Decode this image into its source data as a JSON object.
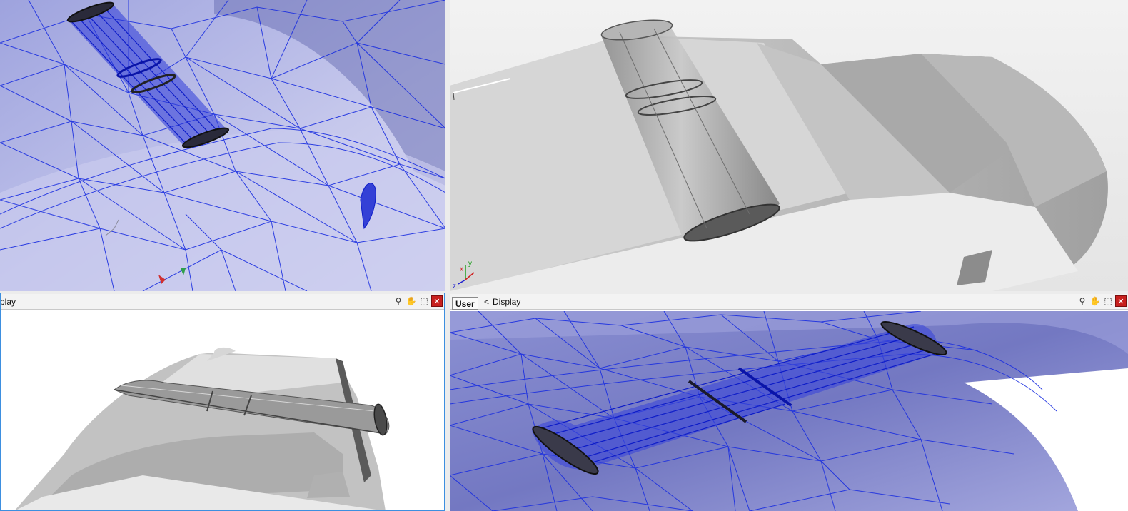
{
  "viewports": {
    "top_left": {
      "style": "wireframe"
    },
    "top_right": {
      "style": "shaded"
    },
    "bottom_left": {
      "style": "shaded",
      "view_label": "play"
    },
    "bottom_right": {
      "style": "wireframe",
      "user_label": "User",
      "nav": "<",
      "view_label": "Display"
    }
  },
  "toolbar_icons": [
    "zoom-icon",
    "pan-hand-icon",
    "zoom-extents-icon",
    "close-viewport-icon"
  ],
  "axis_labels": {
    "x": "x",
    "y": "y",
    "z": "z"
  },
  "colors": {
    "wire": "#1a2ee0",
    "wire_fill": "#b9bde6",
    "active_border": "#3d8fe0",
    "close_button": "#c8201e"
  }
}
